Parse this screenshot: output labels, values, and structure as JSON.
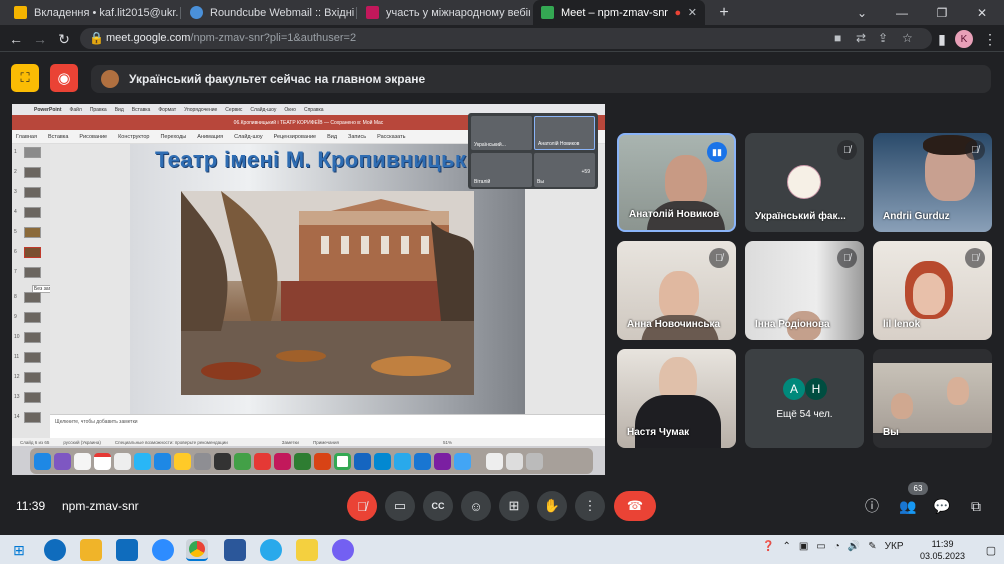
{
  "browser": {
    "tabs": [
      {
        "label": "Вкладення • kaf.lit2015@ukr.net",
        "favicon_color": "#f4b400"
      },
      {
        "label": "Roundcube Webmail :: Вхідні",
        "favicon_color": "#4a90d9"
      },
      {
        "label": "участь у міжнародному вебінар",
        "favicon_color": "#c2185b"
      },
      {
        "label": "Meet – npm-zmav-snr",
        "favicon_color": "#34a853"
      }
    ],
    "new_tab": "+",
    "url_host": "meet.google.com",
    "url_path": "/npm-zmav-snr?pli=1&authuser=2",
    "profile_initial": "K"
  },
  "meet": {
    "presenting_text": "Український факультет сейчас на главном экране",
    "shared_screen": {
      "slide_title": "Театр імені М. Кропивницьк",
      "app_name": "PowerPoint",
      "menu": [
        "PowerPoint",
        "Файл",
        "Правка",
        "Вид",
        "Вставка",
        "Формат",
        "Упорядочение",
        "Сервис",
        "Слайд-шоу",
        "Окно",
        "Справка"
      ],
      "doc_title": "06.Кропивницький і ТЕАТР КОРИФЕЇВ — Сохранено в: Мой Mac",
      "ribbon": [
        "Главная",
        "Вставка",
        "Рисование",
        "Конструктор",
        "Переходы",
        "Анимация",
        "Слайд-шоу",
        "Рецензирование",
        "Вид",
        "Запись",
        "Рассказать"
      ],
      "notes_placeholder": "Щелкните, чтобы добавить заметки",
      "status_left": "Слайд 6 из 65",
      "status_lang": "русский (Украина)",
      "status_access": "Специальные возможности: проверьте рекомендации",
      "status_notes": "Заметки",
      "status_comments": "Примечания",
      "zoom": "51%",
      "thumb_tooltip": "Без заголовка",
      "mini_participants": [
        "Український...",
        "Анатолій Новиков",
        "Віталій",
        "Вы"
      ],
      "mini_more": "+59"
    },
    "participants": [
      {
        "name": "Анатолій Новиков",
        "state": "speaking"
      },
      {
        "name": "Український фак...",
        "state": "muted"
      },
      {
        "name": "Andrii Gurduz",
        "state": "muted"
      },
      {
        "name": "Анна Новочинська",
        "state": "muted"
      },
      {
        "name": "Інна Родіонова",
        "state": "muted"
      },
      {
        "name": "lil lenok",
        "state": "muted"
      },
      {
        "name": "Настя Чумак",
        "state": "normal"
      },
      {
        "name": "Вы",
        "state": "normal"
      }
    ],
    "more_tile": {
      "initials": [
        "A",
        "H"
      ],
      "label": "Ещё 54 чел."
    },
    "controls": {
      "time": "11:39",
      "meeting_code": "npm-zmav-snr",
      "participants_count": "63"
    }
  },
  "taskbar": {
    "language": "УКР",
    "time": "11:39",
    "date": "03.05.2023"
  }
}
